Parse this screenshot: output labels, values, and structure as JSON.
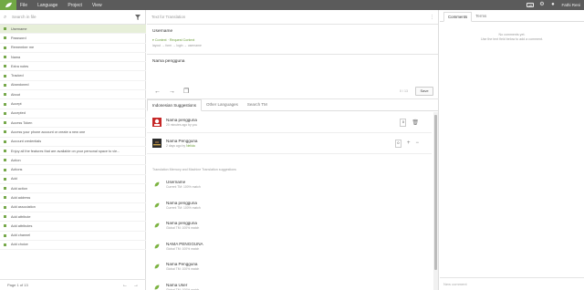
{
  "topbar": {
    "menu": [
      "File",
      "Language",
      "Project",
      "View"
    ],
    "mt_badge": "MT",
    "user": "Fathi Reni"
  },
  "left": {
    "search_placeholder": "Search in file",
    "keys": [
      "Username",
      "Password",
      "Remember me",
      "Nama",
      "Extra notes",
      "Tracked",
      "Abandoned",
      "About",
      "Accept",
      "Accepted",
      "Access Token",
      "Access your phone account or create a new one",
      "Account credentials",
      "Enjoy all the features that are available on your personal space to vie...",
      "Action",
      "Actions",
      "Add",
      "Add action",
      "Add address",
      "Add association",
      "Add attribute",
      "Add attributes",
      "Add channel",
      "Add choice"
    ],
    "selected_index": 0,
    "pagination": "Page 1 of 13"
  },
  "middle": {
    "header": "Text for Translation",
    "source_text": "Username",
    "context_label": "▾ Context · Request Context",
    "breadcrumb": "layout → form → login → username",
    "translation": "Nama pengguna",
    "char_count": "0 / 13",
    "save_label": "Save",
    "tabs": [
      "Indonesian Suggestions",
      "Other Languages",
      "Search TM"
    ],
    "active_tab": 0,
    "suggestions": [
      {
        "text": "Nama pengguna",
        "meta": "20 minutes ago by you",
        "author": "",
        "votes": "0",
        "action": "🗑"
      },
      {
        "text": "Nama Pengguna",
        "meta": "2 days ago by ",
        "author": "Nelida",
        "votes": "0",
        "action": "+"
      }
    ],
    "tm_header": "Translation Memory and Machine Translation suggestions",
    "tm": [
      {
        "text": "Username",
        "meta": "Current TM: 100% match"
      },
      {
        "text": "Nama pengguna",
        "meta": "Current TM: 100% match"
      },
      {
        "text": "Nama pengguna",
        "meta": "Global TM: 100% match"
      },
      {
        "text": "NAMA PENGGUNA",
        "meta": "Global TM: 100% match"
      },
      {
        "text": "Nama Pengguna",
        "meta": "Global TM: 100% match"
      },
      {
        "text": "Nama User",
        "meta": "Global TM: 100% match"
      }
    ]
  },
  "right": {
    "tabs": [
      "Comments",
      "Terms"
    ],
    "active_tab": 0,
    "empty_title": "No comments yet.",
    "empty_hint": "Use the text field below to add a comment.",
    "new_comment_placeholder": "New comment"
  },
  "colors": {
    "topbar": "#5b5b5b",
    "brand_green": "#71a945",
    "selected_row": "#e7efd9"
  }
}
